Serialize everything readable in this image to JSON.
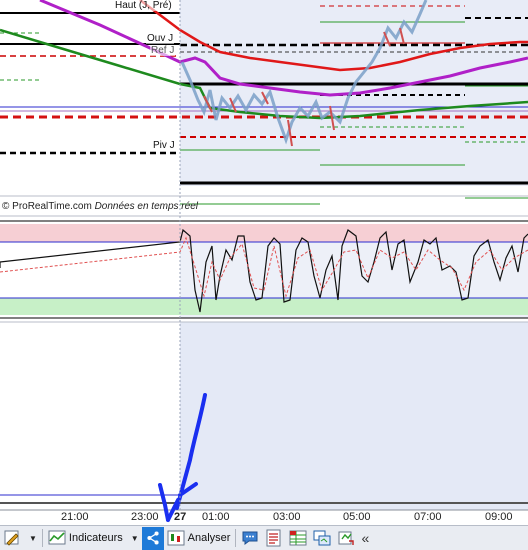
{
  "chart": {
    "levels": {
      "haut": "Haut (J, Pré)",
      "ouv": "Ouv J",
      "ref": "Ref J",
      "piv": "Piv J"
    },
    "copyright": {
      "brand": "© ProRealTime.com",
      "realtime": "Données en temps réel"
    },
    "time_axis": [
      "21:00",
      "23:00",
      "27",
      "01:00",
      "03:00",
      "05:00",
      "07:00",
      "09:00"
    ],
    "colors": {
      "ma_red": "#e01818",
      "ma_magenta": "#b020c8",
      "ma_green": "#1e8a1e",
      "overbought_zone": "#f6cfd4",
      "oversold_zone": "#c7f0c7",
      "session_shade": "#e4e9f6",
      "annotation_blue": "#1a2ff0"
    }
  },
  "toolbar": {
    "indicators_label": "Indicateurs",
    "analyse_label": "Analyser",
    "double_chevron": "«",
    "icons": [
      "pencil-icon",
      "indicators-chart-icon",
      "share-icon",
      "candle-chart-icon",
      "chat-icon",
      "list-icon",
      "table-icon",
      "windows-icon",
      "refresh-icon"
    ]
  }
}
